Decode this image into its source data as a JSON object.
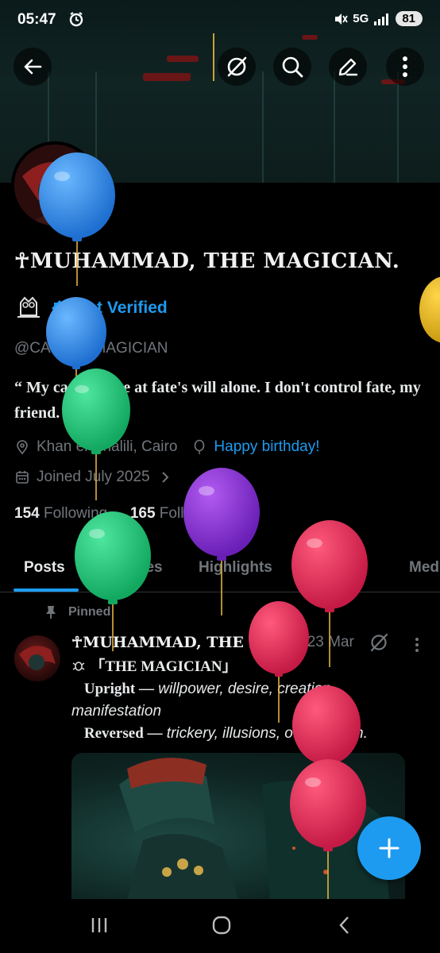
{
  "status_bar": {
    "time": "05:47",
    "network": "5G",
    "battery": "81"
  },
  "profile": {
    "name": "☥MUHAMMAD, THE MAGICIAN.",
    "verified_cta": "Get Verified",
    "handle": "@CARD_I_MAGICIAN",
    "bio": "“ My cards move at fate's will alone. I don't control fate, my friend. ”",
    "location": "Khan el-Khalili, Cairo",
    "birthday": "Happy birthday!",
    "joined": "Joined July 2025",
    "following_count": "154",
    "following_label": "Following",
    "followers_count": "165",
    "followers_label": "Followers"
  },
  "tabs": [
    "Posts",
    "Replies",
    "Highlights",
    "Articles",
    "Media"
  ],
  "active_tab": "Posts",
  "pinned_post": {
    "pinned_label": "Pinned",
    "author": "☥MUHAMMAD, THE MA...",
    "date": "23 Mar",
    "line1": "「THE MAGICIAN」",
    "upright_label": "Upright —",
    "upright_text": "willpower, desire, creation, manifestation",
    "reversed_label": "Reversed —",
    "reversed_text": "trickery, illusions, out of touch."
  },
  "colors": {
    "accent": "#1d9bf0",
    "muted": "#71767b",
    "background": "#000000"
  },
  "icons": [
    "back-arrow-icon",
    "grok-icon",
    "search-icon",
    "edit-icon",
    "more-vert-icon",
    "location-pin-icon",
    "balloon-outline-icon",
    "calendar-icon",
    "chevron-right-icon",
    "pin-icon",
    "plus-icon"
  ]
}
